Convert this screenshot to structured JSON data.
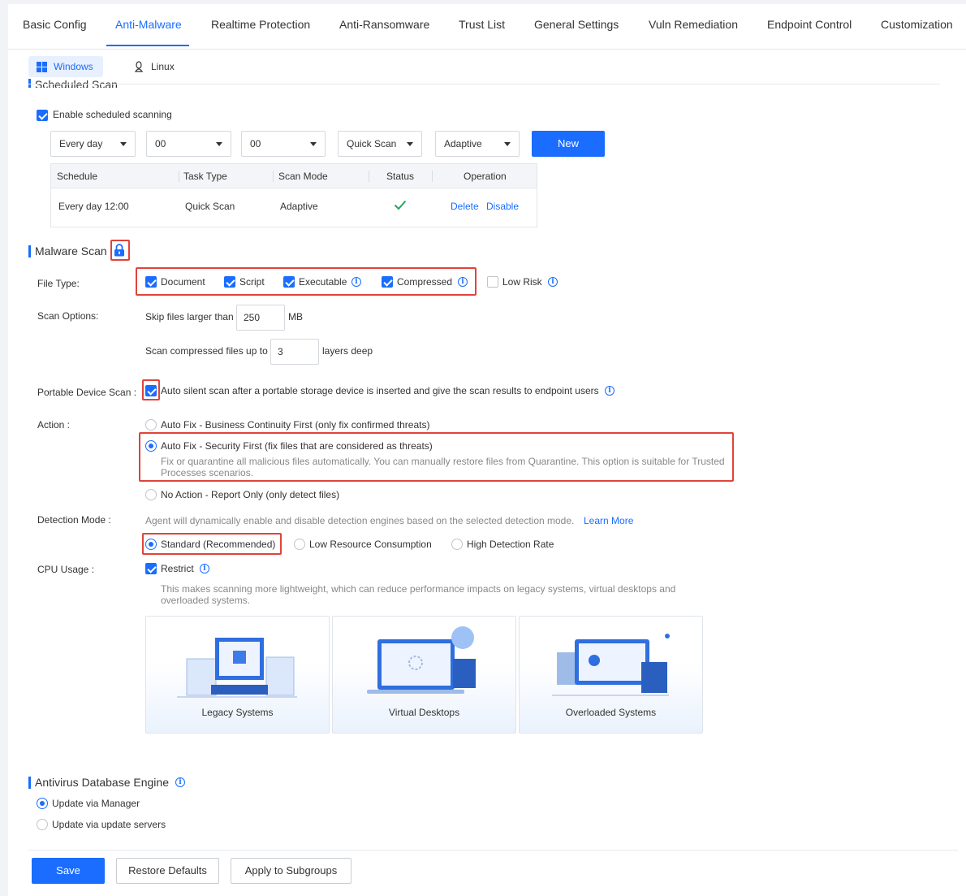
{
  "tabs": [
    "Basic Config",
    "Anti-Malware",
    "Realtime Protection",
    "Anti-Ransomware",
    "Trust List",
    "General Settings",
    "Vuln Remediation",
    "Endpoint Control",
    "Customization"
  ],
  "os_tabs": {
    "windows": "Windows",
    "linux": "Linux"
  },
  "scheduled": {
    "title": "Scheduled Scan",
    "enable_label": "Enable scheduled scanning",
    "freq": "Every day",
    "hour": "00",
    "minute": "00",
    "task_type": "Quick Scan",
    "mode": "Adaptive",
    "new_label": "New",
    "columns": [
      "Schedule",
      "Task Type",
      "Scan Mode",
      "Status",
      "Operation"
    ],
    "row": {
      "schedule": "Every day 12:00",
      "task_type": "Quick Scan",
      "scan_mode": "Adaptive",
      "delete": "Delete",
      "disable": "Disable"
    }
  },
  "malware": {
    "title": "Malware Scan",
    "file_type_label": "File Type:",
    "file_types": [
      "Document",
      "Script",
      "Executable",
      "Compressed",
      "Low Risk"
    ],
    "scan_options_label": "Scan Options:",
    "skip_prefix": "Skip files larger than",
    "skip_value": "250",
    "skip_unit": "MB",
    "compressed_prefix": "Scan compressed files up to",
    "compressed_value": "3",
    "compressed_unit": "layers deep",
    "portable_label": "Portable Device Scan :",
    "portable_text": "Auto silent scan after a portable storage device is inserted and give the scan results to endpoint users",
    "action_label": "Action :",
    "action_1": "Auto Fix - Business Continuity First (only fix confirmed threats)",
    "action_2": "Auto Fix - Security First (fix files that are considered as threats)",
    "action_2_desc": "Fix or quarantine all malicious files automatically. You can manually restore files from Quarantine. This option is suitable for Trusted Processes scenarios.",
    "action_3": "No Action - Report Only (only detect files)",
    "detection_label": "Detection Mode :",
    "detection_desc": "Agent will dynamically enable and disable detection engines based on the selected detection mode.",
    "learn_more": "Learn More",
    "modes": [
      "Standard (Recommended)",
      "Low Resource Consumption",
      "High Detection Rate"
    ],
    "cpu_label": "CPU Usage :",
    "restrict": "Restrict",
    "cpu_desc": "This makes scanning more lightweight, which can reduce performance impacts on legacy systems, virtual desktops and overloaded systems.",
    "cards": [
      "Legacy Systems",
      "Virtual Desktops",
      "Overloaded Systems"
    ]
  },
  "engine": {
    "title": "Antivirus Database Engine",
    "opt_1": "Update via Manager",
    "opt_2": "Update via update servers"
  },
  "footer": {
    "save": "Save",
    "restore": "Restore Defaults",
    "apply": "Apply to Subgroups"
  },
  "colors": {
    "accent": "#1a6dff",
    "highlight": "#e0443a",
    "success": "#27a65a"
  }
}
